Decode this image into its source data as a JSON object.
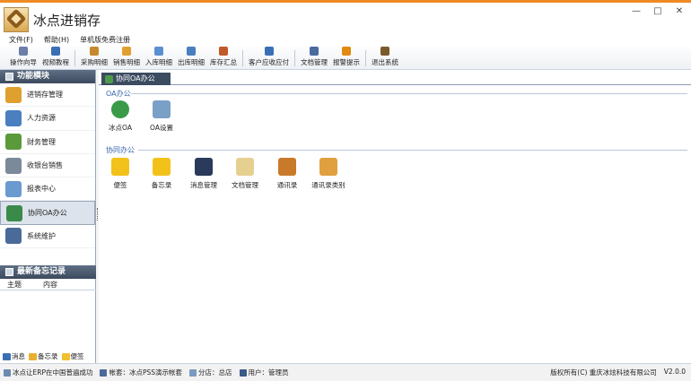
{
  "app": {
    "title": "冰点进销存"
  },
  "window_controls": {
    "minimize": "—",
    "maximize": "□",
    "close": "✕"
  },
  "menu": [
    "文件(F)",
    "帮助(H)",
    "单机版免费注册"
  ],
  "toolbar": [
    {
      "label": "操作向导",
      "icon": "wand-icon",
      "color": "#6b7fa8"
    },
    {
      "label": "视频教程",
      "icon": "film-icon",
      "color": "#3a6fb5"
    },
    {
      "label": "采购明细",
      "icon": "purchase-icon",
      "color": "#c68a2e"
    },
    {
      "label": "销售明细",
      "icon": "cart-icon",
      "color": "#e0a030"
    },
    {
      "label": "入库明细",
      "icon": "inbound-icon",
      "color": "#5a8fd0"
    },
    {
      "label": "出库明细",
      "icon": "outbound-icon",
      "color": "#4a7fc0"
    },
    {
      "label": "库存汇总",
      "icon": "stock-icon",
      "color": "#c05a2a"
    },
    {
      "label": "客户应收应付",
      "icon": "customer-icon",
      "color": "#3a6fb5"
    },
    {
      "label": "文档管理",
      "icon": "document-icon",
      "color": "#4a6aa0"
    },
    {
      "label": "报警提示",
      "icon": "alarm-icon",
      "color": "#e08a10"
    },
    {
      "label": "退出系统",
      "icon": "exit-icon",
      "color": "#7a5a2a"
    }
  ],
  "left": {
    "modules_title": "功能模块",
    "modules": [
      {
        "label": "进销存管理",
        "icon": "inventory-icon",
        "color": "#e0a030",
        "selected": false
      },
      {
        "label": "人力资源",
        "icon": "people-icon",
        "color": "#4a7fc0",
        "selected": false
      },
      {
        "label": "财务管理",
        "icon": "finance-icon",
        "color": "#5a9a3a",
        "selected": false
      },
      {
        "label": "收银台销售",
        "icon": "cashier-icon",
        "color": "#7a8a9a",
        "selected": false
      },
      {
        "label": "报表中心",
        "icon": "report-icon",
        "color": "#6a9ad0",
        "selected": false
      },
      {
        "label": "协同OA办公",
        "icon": "oa-icon",
        "color": "#3a8a4a",
        "selected": true
      },
      {
        "label": "系统维护",
        "icon": "tools-icon",
        "color": "#4a6a9a",
        "selected": false
      }
    ],
    "memo_title": "最新备忘记录",
    "memo_columns": [
      "主题",
      "内容"
    ],
    "footer": [
      {
        "label": "消息",
        "icon": "message-icon",
        "color": "#3a6fb5"
      },
      {
        "label": "备忘录",
        "icon": "memo-icon",
        "color": "#e8b030"
      },
      {
        "label": "便签",
        "icon": "sticky-note-icon",
        "color": "#f0c030"
      }
    ]
  },
  "main": {
    "tab_label": "协同OA办公",
    "groups": [
      {
        "title": "OA办公",
        "items": [
          {
            "label": "冰点OA",
            "icon": "globe-icon",
            "color": "#3a9a4a"
          },
          {
            "label": "OA设置",
            "icon": "settings-icon",
            "color": "#7aa0c8"
          }
        ]
      },
      {
        "title": "协同办公",
        "items": [
          {
            "label": "便签",
            "icon": "sticky-note-icon",
            "color": "#f2c21a"
          },
          {
            "label": "备忘录",
            "icon": "memo-pencil-icon",
            "color": "#f2c21a"
          },
          {
            "label": "消息管理",
            "icon": "chat-icon",
            "color": "#2a3a5a"
          },
          {
            "label": "文档管理",
            "icon": "documents-icon",
            "color": "#e6d090"
          },
          {
            "label": "通讯录",
            "icon": "address-book-icon",
            "color": "#c87a2a"
          },
          {
            "label": "通讯录类别",
            "icon": "contact-category-icon",
            "color": "#e0a040"
          }
        ]
      }
    ]
  },
  "status": {
    "left": [
      {
        "text": "冰点让ERP在中国普遍成功",
        "icon": "info-icon",
        "color": "#6a8ab0"
      },
      {
        "text": "帐套：冰点PSS演示帐套",
        "icon": "account-icon",
        "color": "#4a6a9a"
      },
      {
        "text": "分店：总店",
        "icon": "store-icon",
        "color": "#7a9ac0"
      },
      {
        "text": "用户：管理员",
        "icon": "user-icon",
        "color": "#3a5a8a"
      }
    ],
    "copyright": "版权所有(C) 重庆冰炫科技有限公司",
    "version": "V2.0.0"
  }
}
